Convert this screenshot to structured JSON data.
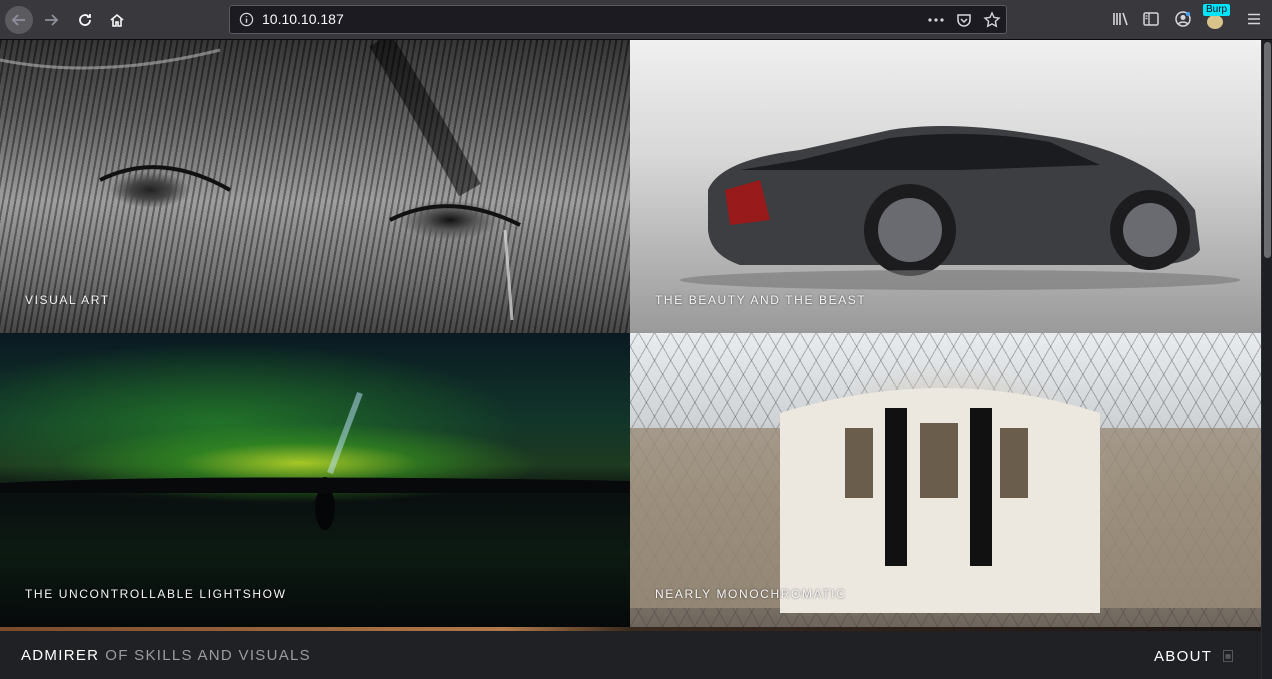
{
  "browser": {
    "url": "10.10.10.187",
    "burp_badge": "Burp",
    "icons": {
      "back": "back-arrow-icon",
      "forward": "forward-arrow-icon",
      "reload": "reload-icon",
      "home": "home-icon",
      "info": "info-icon",
      "page_actions": "more-dots-icon",
      "pocket": "pocket-icon",
      "bookmark": "star-icon",
      "library": "library-icon",
      "sidebar": "sidebar-icon",
      "account": "account-icon",
      "menu": "hamburger-menu-icon"
    }
  },
  "gallery": {
    "tiles": [
      {
        "caption": "Visual Art"
      },
      {
        "caption": "The Beauty and the Beast"
      },
      {
        "caption": "The Uncontrollable Lightshow"
      },
      {
        "caption": "Nearly Monochromatic"
      }
    ]
  },
  "footer": {
    "brand_main": "ADMIRER",
    "brand_sub": "OF SKILLS AND VISUALS",
    "about_label": "ABOUT"
  },
  "colors": {
    "toolbar_bg": "#38383d",
    "urlbar_bg": "#1c1b22",
    "footer_bg": "#1f2125",
    "burp_badge": "#00e5ff"
  }
}
